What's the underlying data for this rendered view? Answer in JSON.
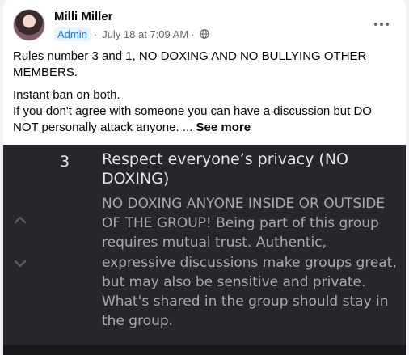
{
  "post": {
    "author": "Milli Miller",
    "role_badge": "Admin",
    "date": "July 18 at 7:09 AM",
    "separator": "·",
    "privacy_icon": "globe-icon",
    "more_icon": "more-horizontal-icon",
    "paragraph1": "Rules number 3 and 1, NO DOXING AND NO BULLYING OTHER MEMBERS.",
    "paragraph2_line1": "Instant ban on both.",
    "paragraph2_line2": "If you don't agree with someone you can have a discussion but DO NOT personally attack anyone. ...",
    "see_more": "See more"
  },
  "rule_image": {
    "number": "3",
    "title": "Respect everyone’s privacy (NO DOXING)",
    "description": "NO DOXING ANYONE INSIDE OR OUTSIDE OF THE GROUP! Being part of this group requires mutual trust. Authentic, expressive discussions make groups great, but may also be sensitive and private. What's shared in the group should stay in the group.",
    "up_icon": "chevron-up-icon",
    "down_icon": "chevron-down-icon"
  },
  "colors": {
    "accent": "#1877f2",
    "panel_bg": "#27272b",
    "text_secondary": "#65676b"
  }
}
